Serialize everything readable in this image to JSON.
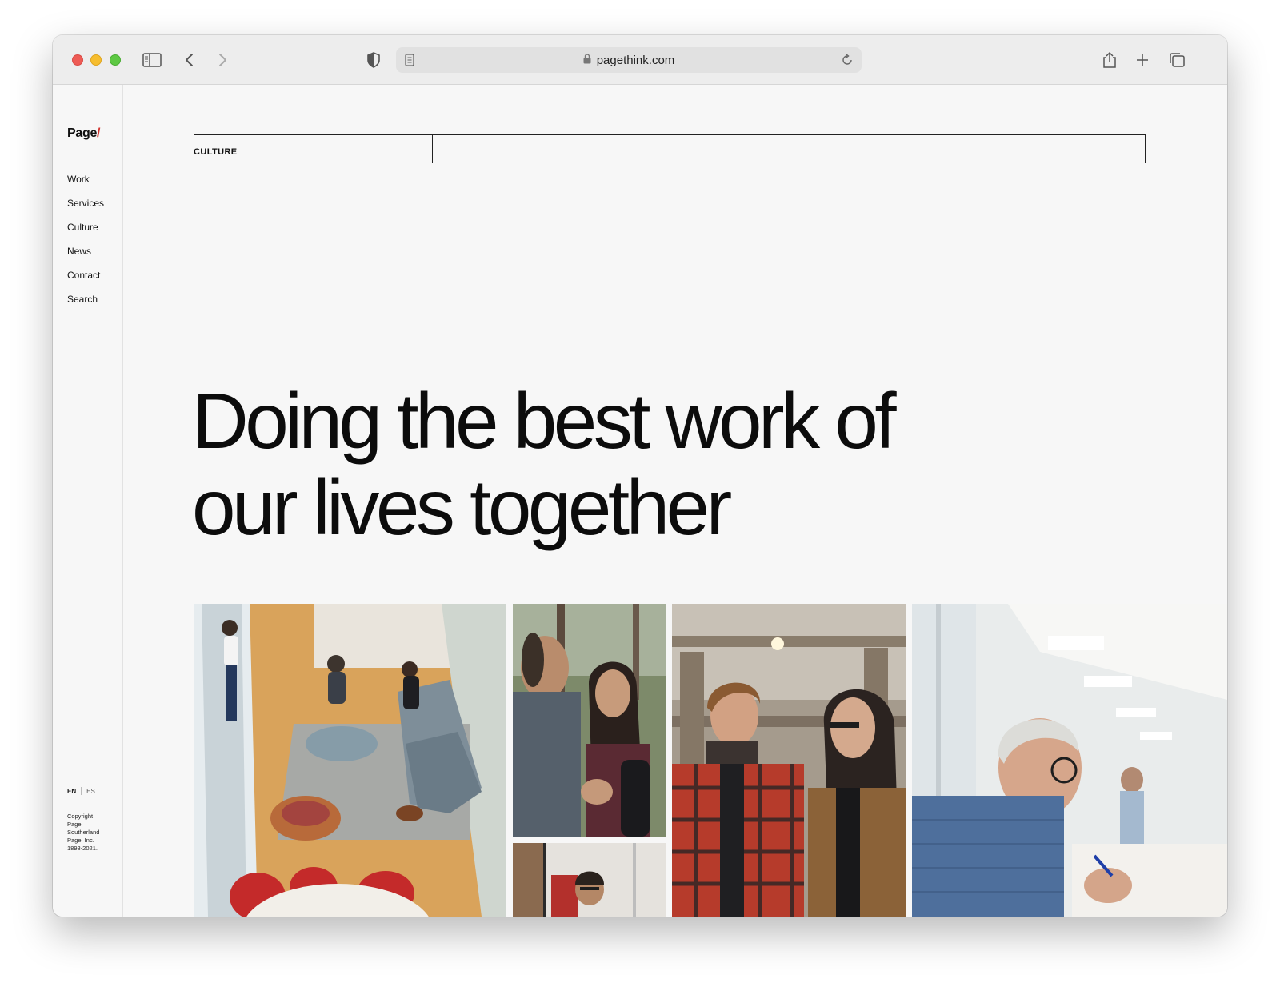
{
  "browser": {
    "url": "pagethink.com"
  },
  "site": {
    "logo_text": "Page",
    "logo_slash": "/",
    "nav": [
      "Work",
      "Services",
      "Culture",
      "News",
      "Contact",
      "Search"
    ],
    "lang": {
      "en": "EN",
      "es": "ES"
    },
    "copyright": [
      "Copyright",
      "Page",
      "Southerland",
      "Page, Inc.",
      "1898-2021."
    ]
  },
  "main": {
    "section_label": "CULTURE",
    "headline_line1": "Doing the best work of",
    "headline_line2": "our lives together"
  },
  "colors": {
    "accent": "#d2322d",
    "page_bg": "#f7f7f7"
  }
}
